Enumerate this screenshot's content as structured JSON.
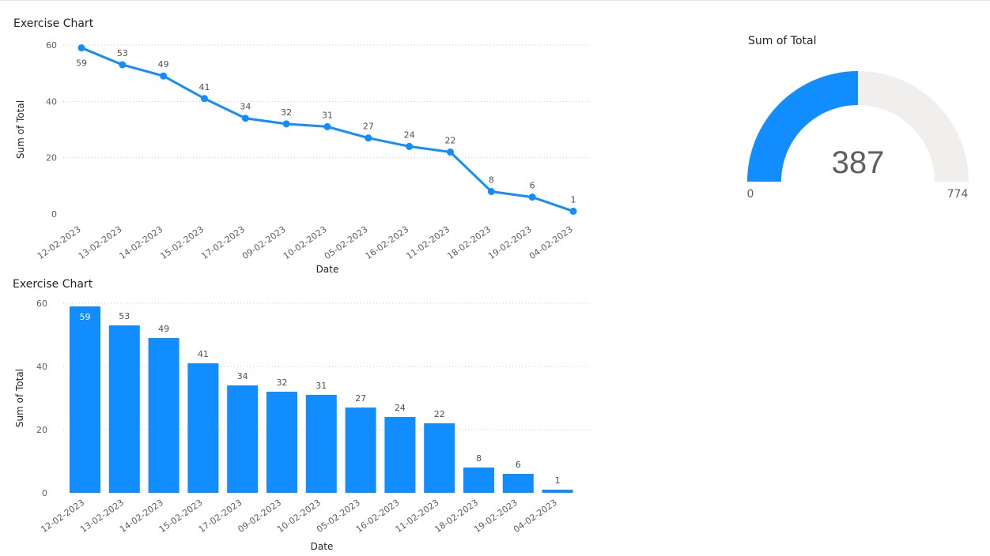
{
  "page": {
    "background": "#ffffff"
  },
  "line_visual": {
    "title": "Exercise Chart"
  },
  "bar_visual": {
    "title": "Exercise Chart"
  },
  "gauge_visual": {
    "title": "Sum of Total",
    "value": 387,
    "value_label": "387",
    "min": 0,
    "max": 774,
    "min_label": "0",
    "max_label": "774",
    "fill_color": "#118dff",
    "track_color": "#f0efee"
  },
  "chart_data": [
    {
      "type": "line",
      "title": "Exercise Chart",
      "xlabel": "Date",
      "ylabel": "Sum of Total",
      "ylim": [
        0,
        60
      ],
      "yticks": [
        "0",
        "20",
        "40",
        "60"
      ],
      "grid": true,
      "categories": [
        "12-02-2023",
        "13-02-2023",
        "14-02-2023",
        "15-02-2023",
        "17-02-2023",
        "09-02-2023",
        "10-02-2023",
        "05-02-2023",
        "16-02-2023",
        "11-02-2023",
        "18-02-2023",
        "19-02-2023",
        "04-02-2023"
      ],
      "values": [
        59,
        53,
        49,
        41,
        34,
        32,
        31,
        27,
        24,
        22,
        8,
        6,
        1
      ],
      "color": "#118dff"
    },
    {
      "type": "bar",
      "title": "Exercise Chart",
      "xlabel": "Date",
      "ylabel": "Sum of Total",
      "ylim": [
        0,
        60
      ],
      "yticks": [
        "0",
        "20",
        "40",
        "60"
      ],
      "grid": true,
      "categories": [
        "12-02-2023",
        "13-02-2023",
        "14-02-2023",
        "15-02-2023",
        "17-02-2023",
        "09-02-2023",
        "10-02-2023",
        "05-02-2023",
        "16-02-2023",
        "11-02-2023",
        "18-02-2023",
        "19-02-2023",
        "04-02-2023"
      ],
      "values": [
        59,
        53,
        49,
        41,
        34,
        32,
        31,
        27,
        24,
        22,
        8,
        6,
        1
      ],
      "color": "#118dff"
    }
  ]
}
